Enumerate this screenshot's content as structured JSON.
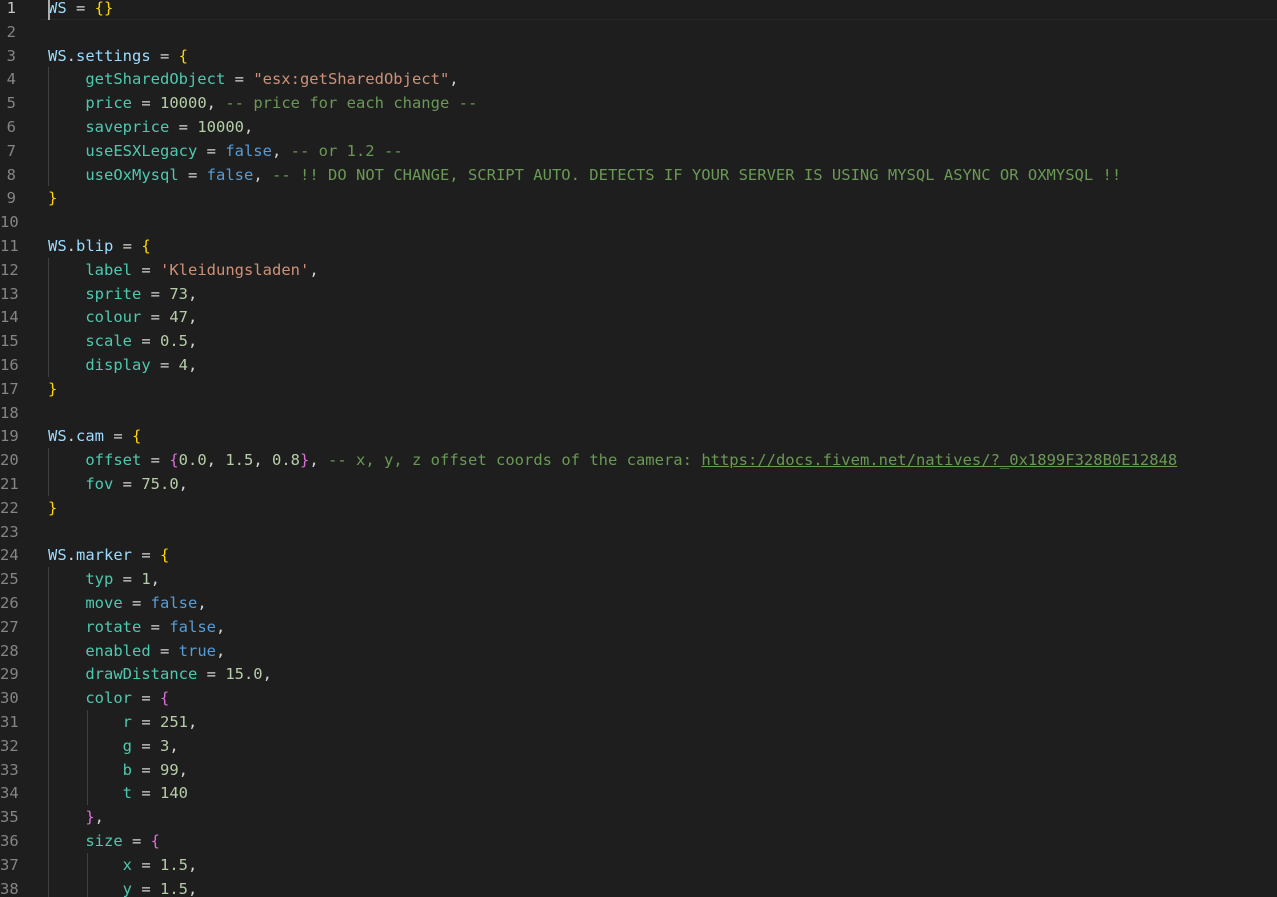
{
  "editor": {
    "lines": [
      {
        "n": "1",
        "segs": [
          [
            "var",
            "WS"
          ],
          [
            "op",
            " = "
          ],
          [
            "br1",
            "{}"
          ]
        ]
      },
      {
        "n": "2",
        "segs": []
      },
      {
        "n": "3",
        "segs": [
          [
            "var",
            "WS"
          ],
          [
            "op",
            "."
          ],
          [
            "prop",
            "settings"
          ],
          [
            "op",
            " = "
          ],
          [
            "br1",
            "{"
          ]
        ]
      },
      {
        "n": "4",
        "segs": [
          [
            "op",
            "    "
          ],
          [
            "key",
            "getSharedObject"
          ],
          [
            "op",
            " = "
          ],
          [
            "str",
            "\"esx:getSharedObject\""
          ],
          [
            "op",
            ","
          ]
        ]
      },
      {
        "n": "5",
        "segs": [
          [
            "op",
            "    "
          ],
          [
            "key",
            "price"
          ],
          [
            "op",
            " = "
          ],
          [
            "num",
            "10000"
          ],
          [
            "op",
            ", "
          ],
          [
            "com",
            "-- price for each change --"
          ]
        ]
      },
      {
        "n": "6",
        "segs": [
          [
            "op",
            "    "
          ],
          [
            "key",
            "saveprice"
          ],
          [
            "op",
            " = "
          ],
          [
            "num",
            "10000"
          ],
          [
            "op",
            ","
          ]
        ]
      },
      {
        "n": "7",
        "segs": [
          [
            "op",
            "    "
          ],
          [
            "key",
            "useESXLegacy"
          ],
          [
            "op",
            " = "
          ],
          [
            "bool",
            "false"
          ],
          [
            "op",
            ", "
          ],
          [
            "com",
            "-- or 1.2 --"
          ]
        ]
      },
      {
        "n": "8",
        "segs": [
          [
            "op",
            "    "
          ],
          [
            "key",
            "useOxMysql"
          ],
          [
            "op",
            " = "
          ],
          [
            "bool",
            "false"
          ],
          [
            "op",
            ", "
          ],
          [
            "com",
            "-- !! DO NOT CHANGE, SCRIPT AUTO. DETECTS IF YOUR SERVER IS USING MYSQL ASYNC OR OXMYSQL !!"
          ]
        ]
      },
      {
        "n": "9",
        "segs": [
          [
            "br1",
            "}"
          ]
        ]
      },
      {
        "n": "10",
        "segs": []
      },
      {
        "n": "11",
        "segs": [
          [
            "var",
            "WS"
          ],
          [
            "op",
            "."
          ],
          [
            "prop",
            "blip"
          ],
          [
            "op",
            " = "
          ],
          [
            "br1",
            "{"
          ]
        ]
      },
      {
        "n": "12",
        "segs": [
          [
            "op",
            "    "
          ],
          [
            "key",
            "label"
          ],
          [
            "op",
            " = "
          ],
          [
            "str",
            "'Kleidungsladen'"
          ],
          [
            "op",
            ","
          ]
        ]
      },
      {
        "n": "13",
        "segs": [
          [
            "op",
            "    "
          ],
          [
            "key",
            "sprite"
          ],
          [
            "op",
            " = "
          ],
          [
            "num",
            "73"
          ],
          [
            "op",
            ","
          ]
        ]
      },
      {
        "n": "14",
        "segs": [
          [
            "op",
            "    "
          ],
          [
            "key",
            "colour"
          ],
          [
            "op",
            " = "
          ],
          [
            "num",
            "47"
          ],
          [
            "op",
            ","
          ]
        ]
      },
      {
        "n": "15",
        "segs": [
          [
            "op",
            "    "
          ],
          [
            "key",
            "scale"
          ],
          [
            "op",
            " = "
          ],
          [
            "num",
            "0.5"
          ],
          [
            "op",
            ","
          ]
        ]
      },
      {
        "n": "16",
        "segs": [
          [
            "op",
            "    "
          ],
          [
            "key",
            "display"
          ],
          [
            "op",
            " = "
          ],
          [
            "num",
            "4"
          ],
          [
            "op",
            ","
          ]
        ]
      },
      {
        "n": "17",
        "segs": [
          [
            "br1",
            "}"
          ]
        ]
      },
      {
        "n": "18",
        "segs": []
      },
      {
        "n": "19",
        "segs": [
          [
            "var",
            "WS"
          ],
          [
            "op",
            "."
          ],
          [
            "prop",
            "cam"
          ],
          [
            "op",
            " = "
          ],
          [
            "br1",
            "{"
          ]
        ]
      },
      {
        "n": "20",
        "segs": [
          [
            "op",
            "    "
          ],
          [
            "key",
            "offset"
          ],
          [
            "op",
            " = "
          ],
          [
            "br2",
            "{"
          ],
          [
            "num",
            "0.0"
          ],
          [
            "op",
            ", "
          ],
          [
            "num",
            "1.5"
          ],
          [
            "op",
            ", "
          ],
          [
            "num",
            "0.8"
          ],
          [
            "br2",
            "}"
          ],
          [
            "op",
            ", "
          ],
          [
            "com",
            "-- x, y, z offset coords of the camera: "
          ],
          [
            "link",
            "https://docs.fivem.net/natives/?_0x1899F328B0E12848"
          ]
        ]
      },
      {
        "n": "21",
        "segs": [
          [
            "op",
            "    "
          ],
          [
            "key",
            "fov"
          ],
          [
            "op",
            " = "
          ],
          [
            "num",
            "75.0"
          ],
          [
            "op",
            ","
          ]
        ]
      },
      {
        "n": "22",
        "segs": [
          [
            "br1",
            "}"
          ]
        ]
      },
      {
        "n": "23",
        "segs": []
      },
      {
        "n": "24",
        "segs": [
          [
            "var",
            "WS"
          ],
          [
            "op",
            "."
          ],
          [
            "prop",
            "marker"
          ],
          [
            "op",
            " = "
          ],
          [
            "br1",
            "{"
          ]
        ]
      },
      {
        "n": "25",
        "segs": [
          [
            "op",
            "    "
          ],
          [
            "key",
            "typ"
          ],
          [
            "op",
            " = "
          ],
          [
            "num",
            "1"
          ],
          [
            "op",
            ","
          ]
        ]
      },
      {
        "n": "26",
        "segs": [
          [
            "op",
            "    "
          ],
          [
            "key",
            "move"
          ],
          [
            "op",
            " = "
          ],
          [
            "bool",
            "false"
          ],
          [
            "op",
            ","
          ]
        ]
      },
      {
        "n": "27",
        "segs": [
          [
            "op",
            "    "
          ],
          [
            "key",
            "rotate"
          ],
          [
            "op",
            " = "
          ],
          [
            "bool",
            "false"
          ],
          [
            "op",
            ","
          ]
        ]
      },
      {
        "n": "28",
        "segs": [
          [
            "op",
            "    "
          ],
          [
            "key",
            "enabled"
          ],
          [
            "op",
            " = "
          ],
          [
            "bool",
            "true"
          ],
          [
            "op",
            ","
          ]
        ]
      },
      {
        "n": "29",
        "segs": [
          [
            "op",
            "    "
          ],
          [
            "key",
            "drawDistance"
          ],
          [
            "op",
            " = "
          ],
          [
            "num",
            "15.0"
          ],
          [
            "op",
            ","
          ]
        ]
      },
      {
        "n": "30",
        "segs": [
          [
            "op",
            "    "
          ],
          [
            "key",
            "color"
          ],
          [
            "op",
            " = "
          ],
          [
            "br2",
            "{"
          ]
        ]
      },
      {
        "n": "31",
        "segs": [
          [
            "op",
            "        "
          ],
          [
            "key",
            "r"
          ],
          [
            "op",
            " = "
          ],
          [
            "num",
            "251"
          ],
          [
            "op",
            ","
          ]
        ]
      },
      {
        "n": "32",
        "segs": [
          [
            "op",
            "        "
          ],
          [
            "key",
            "g"
          ],
          [
            "op",
            " = "
          ],
          [
            "num",
            "3"
          ],
          [
            "op",
            ","
          ]
        ]
      },
      {
        "n": "33",
        "segs": [
          [
            "op",
            "        "
          ],
          [
            "key",
            "b"
          ],
          [
            "op",
            " = "
          ],
          [
            "num",
            "99"
          ],
          [
            "op",
            ","
          ]
        ]
      },
      {
        "n": "34",
        "segs": [
          [
            "op",
            "        "
          ],
          [
            "key",
            "t"
          ],
          [
            "op",
            " = "
          ],
          [
            "num",
            "140"
          ]
        ]
      },
      {
        "n": "35",
        "segs": [
          [
            "op",
            "    "
          ],
          [
            "br2",
            "}"
          ],
          [
            "op",
            ","
          ]
        ]
      },
      {
        "n": "36",
        "segs": [
          [
            "op",
            "    "
          ],
          [
            "key",
            "size"
          ],
          [
            "op",
            " = "
          ],
          [
            "br2",
            "{"
          ]
        ]
      },
      {
        "n": "37",
        "segs": [
          [
            "op",
            "        "
          ],
          [
            "key",
            "x"
          ],
          [
            "op",
            " = "
          ],
          [
            "num",
            "1.5"
          ],
          [
            "op",
            ","
          ]
        ]
      },
      {
        "n": "38",
        "segs": [
          [
            "op",
            "        "
          ],
          [
            "key",
            "y"
          ],
          [
            "op",
            " = "
          ],
          [
            "num",
            "1.5"
          ],
          [
            "op",
            ","
          ]
        ]
      }
    ]
  },
  "colors": {
    "background": "#1e1e1e",
    "line_number": "#858585",
    "active_line_number": "#c6c6c6",
    "variable": "#9cdcfe",
    "key": "#4ec9b0",
    "number": "#b5cea8",
    "string": "#ce9178",
    "boolean": "#569cd6",
    "comment": "#6a9955",
    "bracket_level_1": "#ffd700",
    "bracket_level_2": "#da70d6"
  }
}
